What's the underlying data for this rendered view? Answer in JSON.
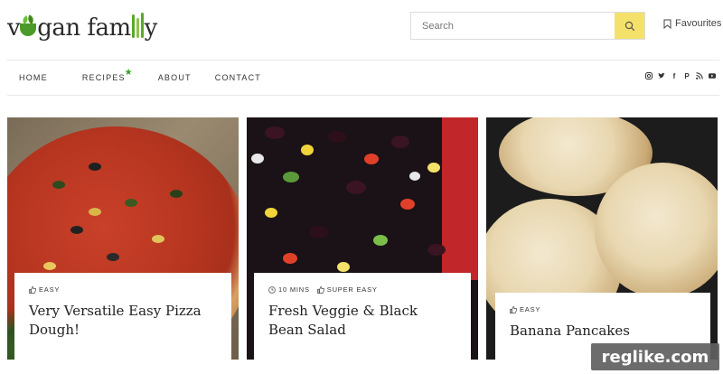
{
  "header": {
    "logo_text": "vegan family",
    "search": {
      "placeholder": "Search"
    },
    "favourites_label": "Favourites"
  },
  "nav": {
    "items": [
      {
        "label": "HOME"
      },
      {
        "label": "RECIPES"
      },
      {
        "label": "ABOUT"
      },
      {
        "label": "CONTACT"
      }
    ],
    "social_icons": [
      "instagram-icon",
      "twitter-icon",
      "facebook-icon",
      "pinterest-icon",
      "rss-icon",
      "youtube-icon"
    ]
  },
  "cards": [
    {
      "tags": [
        {
          "icon": "thumbs-up-icon",
          "text": "EASY"
        }
      ],
      "title": "Very Versatile Easy Pizza Dough!"
    },
    {
      "tags": [
        {
          "icon": "clock-icon",
          "text": "10 MINS"
        },
        {
          "icon": "thumbs-up-icon",
          "text": "SUPER EASY"
        }
      ],
      "title": "Fresh Veggie & Black Bean Salad"
    },
    {
      "tags": [
        {
          "icon": "thumbs-up-icon",
          "text": "EASY"
        }
      ],
      "title": "Banana Pancakes"
    }
  ],
  "watermark": "reglike.com",
  "colors": {
    "accent_yellow": "#f4e169",
    "brand_green": "#4c9a2a"
  }
}
